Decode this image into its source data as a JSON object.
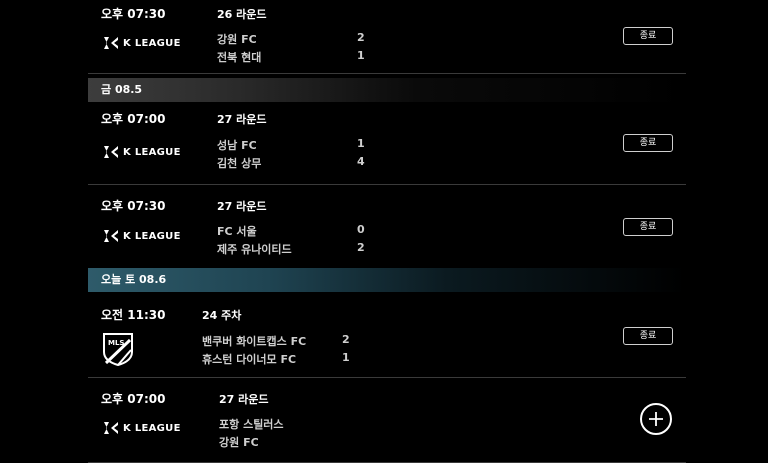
{
  "matches_before": [
    {
      "time": "오후 07:30",
      "round": "26 라운드",
      "league": "K LEAGUE",
      "home": "강원 FC",
      "home_score": "2",
      "away": "전북 현대",
      "away_score": "1",
      "status": "종료"
    }
  ],
  "date_friday": "금 08.5",
  "friday_matches": [
    {
      "time": "오후 07:00",
      "round": "27 라운드",
      "league": "K LEAGUE",
      "home": "성남 FC",
      "home_score": "1",
      "away": "김천 상무",
      "away_score": "4",
      "status": "종료"
    },
    {
      "time": "오후 07:30",
      "round": "27 라운드",
      "league": "K LEAGUE",
      "home": "FC 서울",
      "home_score": "0",
      "away": "제주 유나이티드",
      "away_score": "2",
      "status": "종료"
    }
  ],
  "date_today": "오늘 토 08.6",
  "today_matches": [
    {
      "time": "오전 11:30",
      "round": "24 주차",
      "league": "MLS",
      "home": "밴쿠버 화이트캡스 FC",
      "home_score": "2",
      "away": "휴스턴 다이너모 FC",
      "away_score": "1",
      "status": "종료"
    },
    {
      "time": "오후 07:00",
      "round": "27 라운드",
      "league": "K LEAGUE",
      "home": "포항 스틸러스",
      "away": "강원 FC",
      "action_icon": "plus-icon"
    }
  ]
}
